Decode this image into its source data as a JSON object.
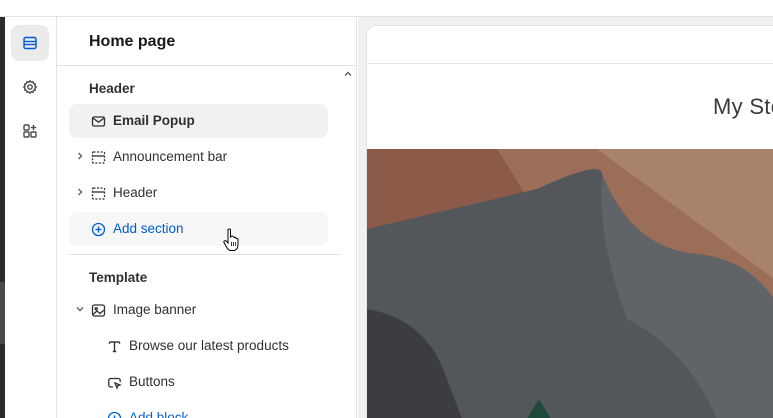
{
  "sidebar": {
    "title": "Home page",
    "groups": {
      "header_label": "Header",
      "template_label": "Template"
    },
    "header_items": [
      {
        "label": "Email Popup",
        "icon": "envelope-icon"
      },
      {
        "label": "Announcement bar",
        "icon": "section-layout-icon"
      },
      {
        "label": "Header",
        "icon": "section-layout-icon"
      }
    ],
    "add_section_label": "Add section",
    "template_items": [
      {
        "label": "Image banner",
        "icon": "image-icon"
      }
    ],
    "image_banner_blocks": [
      {
        "label": "Browse our latest products",
        "icon": "text-icon"
      },
      {
        "label": "Buttons",
        "icon": "button-cursor-icon"
      }
    ],
    "add_block_label": "Add block"
  },
  "rail": {
    "items": [
      "sections-icon",
      "settings-gear-icon",
      "apps-icon"
    ]
  },
  "preview": {
    "store_name": "My Store"
  },
  "colors": {
    "accent_link": "#005bd3",
    "selected_row": "#f1f1f1",
    "text": "#303030"
  }
}
